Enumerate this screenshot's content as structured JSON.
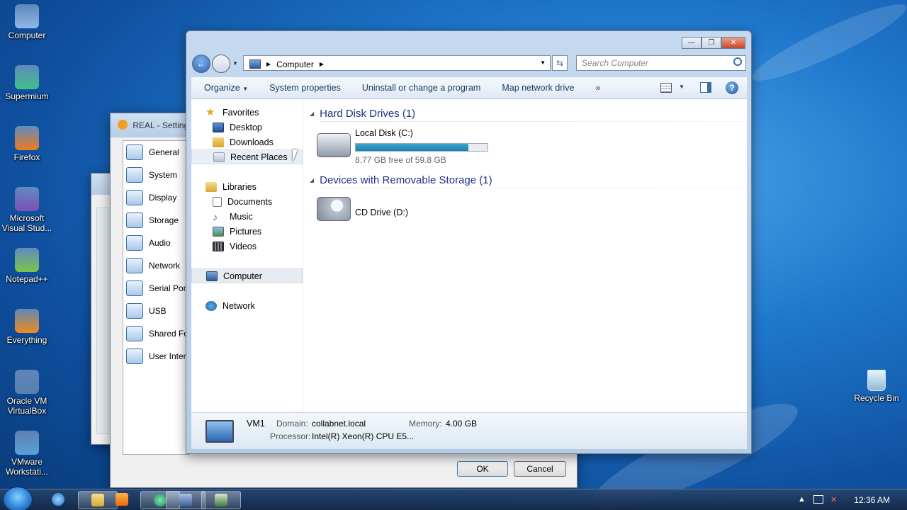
{
  "desktop": {
    "icons": [
      {
        "label": "Computer",
        "icon": "computer-icon",
        "color": "#8fb8e8"
      },
      {
        "label": "Supermium",
        "icon": "supermium-icon",
        "color": "#3fbf8a"
      },
      {
        "label": "Firefox",
        "icon": "firefox-icon",
        "color": "#f07a1e"
      },
      {
        "label": "Microsoft Visual Stud...",
        "icon": "visual-studio-icon",
        "color": "#7e4fb5"
      },
      {
        "label": "Notepad++",
        "icon": "notepadpp-icon",
        "color": "#7cc44a"
      },
      {
        "label": "Everything",
        "icon": "everything-icon",
        "color": "#f08a1e"
      },
      {
        "label": "Oracle VM VirtualBox",
        "icon": "virtualbox-icon",
        "color": "#5a7fb0"
      },
      {
        "label": "VMware Workstati...",
        "icon": "vmware-icon",
        "color": "#5aa0d8"
      }
    ],
    "recycle_bin": "Recycle Bin"
  },
  "vbox_settings": {
    "title": "REAL - Settings",
    "items": [
      {
        "label": "General",
        "icon": "general-icon"
      },
      {
        "label": "System",
        "icon": "system-icon"
      },
      {
        "label": "Display",
        "icon": "display-icon"
      },
      {
        "label": "Storage",
        "icon": "storage-icon"
      },
      {
        "label": "Audio",
        "icon": "audio-icon"
      },
      {
        "label": "Network",
        "icon": "network-icon"
      },
      {
        "label": "Serial Ports",
        "icon": "serial-port-icon"
      },
      {
        "label": "USB",
        "icon": "usb-icon"
      },
      {
        "label": "Shared Folders",
        "icon": "shared-folders-icon"
      },
      {
        "label": "User Interface",
        "icon": "user-interface-icon"
      }
    ],
    "ok": "OK",
    "cancel": "Cancel"
  },
  "explorer": {
    "address": {
      "segments": [
        "Computer"
      ]
    },
    "search_placeholder": "Search Computer",
    "toolbar": {
      "organize": "Organize",
      "system_properties": "System properties",
      "uninstall": "Uninstall or change a program",
      "map_drive": "Map network drive",
      "more": "»"
    },
    "nav": {
      "favorites": "Favorites",
      "fav_items": [
        "Desktop",
        "Downloads",
        "Recent Places"
      ],
      "libraries": "Libraries",
      "lib_items": [
        "Documents",
        "Music",
        "Pictures",
        "Videos"
      ],
      "computer": "Computer",
      "network": "Network"
    },
    "groups": {
      "hdd": "Hard Disk Drives (1)",
      "removable": "Devices with Removable Storage (1)"
    },
    "drives": {
      "c_name": "Local Disk (C:)",
      "c_free": "8.77 GB free of 59.8 GB",
      "c_used_fraction": 0.853,
      "d_name": "CD Drive (D:)"
    },
    "details": {
      "name": "VM1",
      "domain_label": "Domain:",
      "domain": "collabnet.local",
      "memory_label": "Memory:",
      "memory": "4.00 GB",
      "processor_label": "Processor:",
      "processor": "Intel(R) Xeon(R) CPU E5..."
    }
  },
  "taskbar": {
    "clock": "12:36 AM"
  },
  "colors": {
    "accent": "#1e3287",
    "drive_bar": "#1a7fb0"
  }
}
